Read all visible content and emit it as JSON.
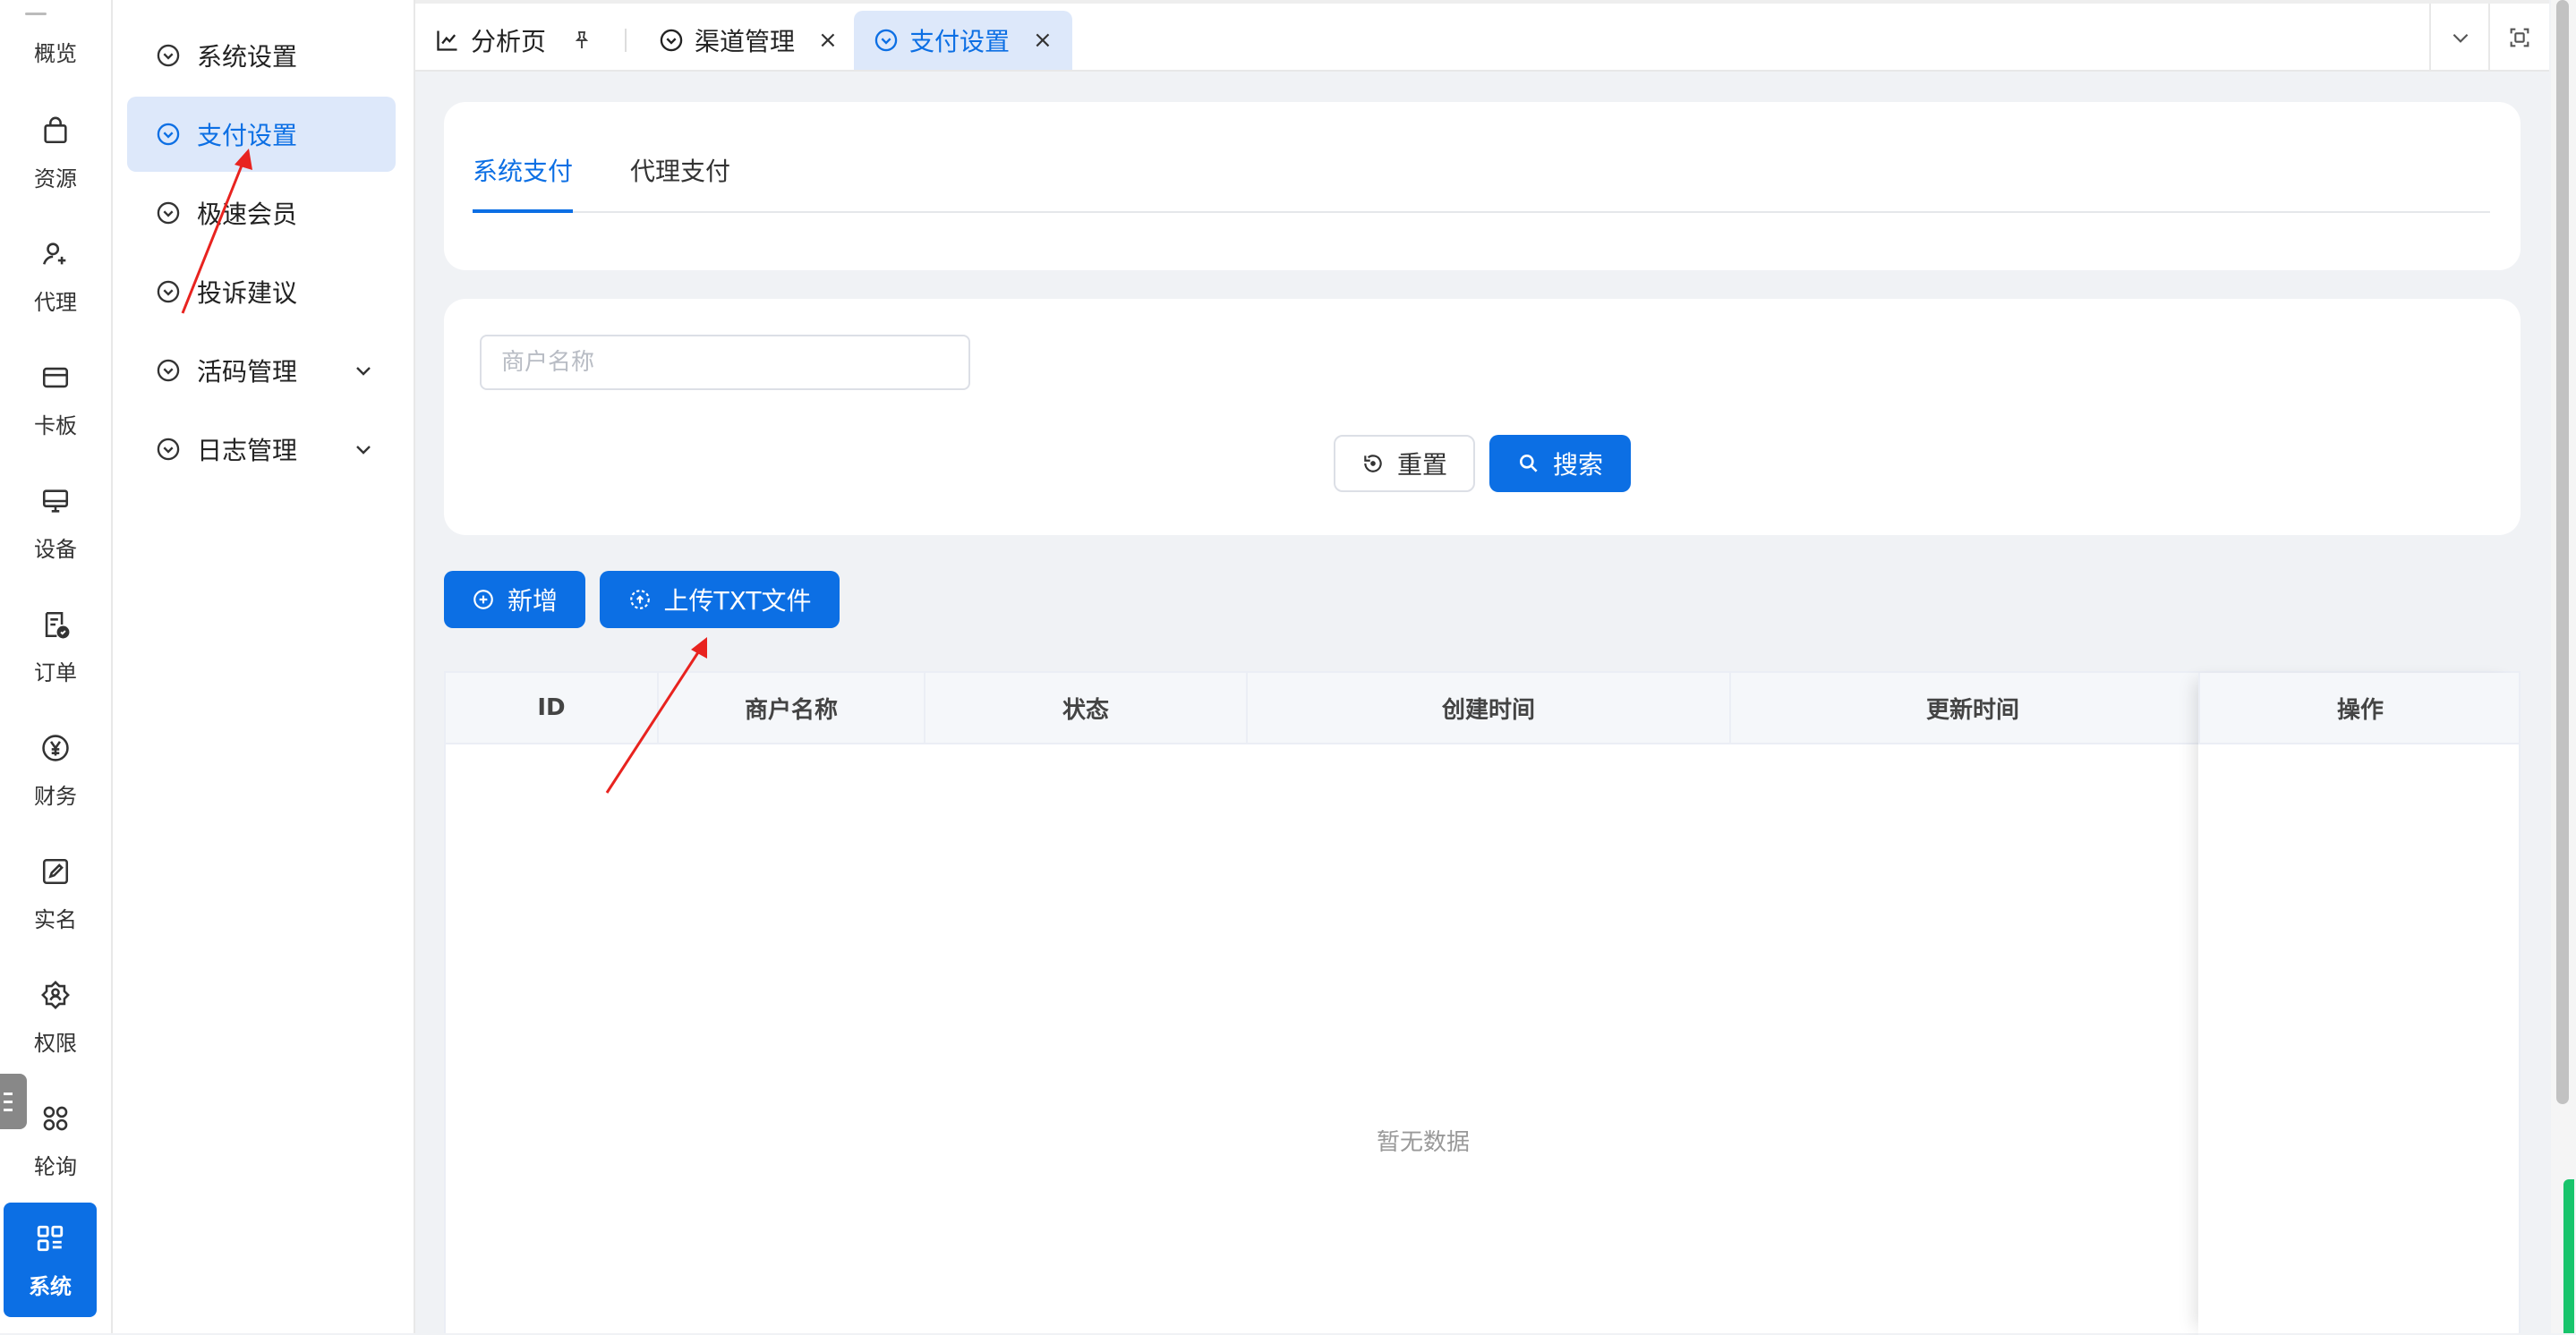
{
  "rail": {
    "items": [
      {
        "label": "概览",
        "icon": "overview-icon"
      },
      {
        "label": "资源",
        "icon": "shopping-bag-icon"
      },
      {
        "label": "代理",
        "icon": "user-add-icon"
      },
      {
        "label": "卡板",
        "icon": "card-icon"
      },
      {
        "label": "设备",
        "icon": "monitor-icon"
      },
      {
        "label": "订单",
        "icon": "order-check-icon"
      },
      {
        "label": "财务",
        "icon": "yen-icon"
      },
      {
        "label": "实名",
        "icon": "edit-square-icon"
      },
      {
        "label": "权限",
        "icon": "user-shield-icon"
      },
      {
        "label": "轮询",
        "icon": "apps-icon"
      },
      {
        "label": "系统",
        "icon": "grid-icon",
        "active": true
      }
    ]
  },
  "submenu": {
    "items": [
      {
        "label": "系统设置"
      },
      {
        "label": "支付设置",
        "active": true
      },
      {
        "label": "极速会员"
      },
      {
        "label": "投诉建议"
      },
      {
        "label": "活码管理",
        "has_children": true
      },
      {
        "label": "日志管理",
        "has_children": true
      }
    ]
  },
  "tabs": [
    {
      "label": "分析页",
      "icon": "chart-icon",
      "pinned": true
    },
    {
      "label": "渠道管理",
      "icon": "circle-chevron-icon",
      "closable": true
    },
    {
      "label": "支付设置",
      "icon": "circle-chevron-icon",
      "closable": true,
      "active": true
    }
  ],
  "tab_close_glyph": "×",
  "page": {
    "inner_tabs": [
      "系统支付",
      "代理支付"
    ],
    "search": {
      "merchant_placeholder": "商户名称",
      "reset_label": "重置",
      "search_label": "搜索"
    },
    "actions": {
      "add_label": "新增",
      "upload_label": "上传TXT文件"
    },
    "table": {
      "columns": [
        "ID",
        "商户名称",
        "状态",
        "创建时间",
        "更新时间",
        "操作"
      ],
      "rows": [],
      "empty_text": "暂无数据"
    }
  },
  "colors": {
    "primary": "#0c6fe4",
    "active_bg": "#dde8fa",
    "annotation_arrow": "#e8231f"
  }
}
